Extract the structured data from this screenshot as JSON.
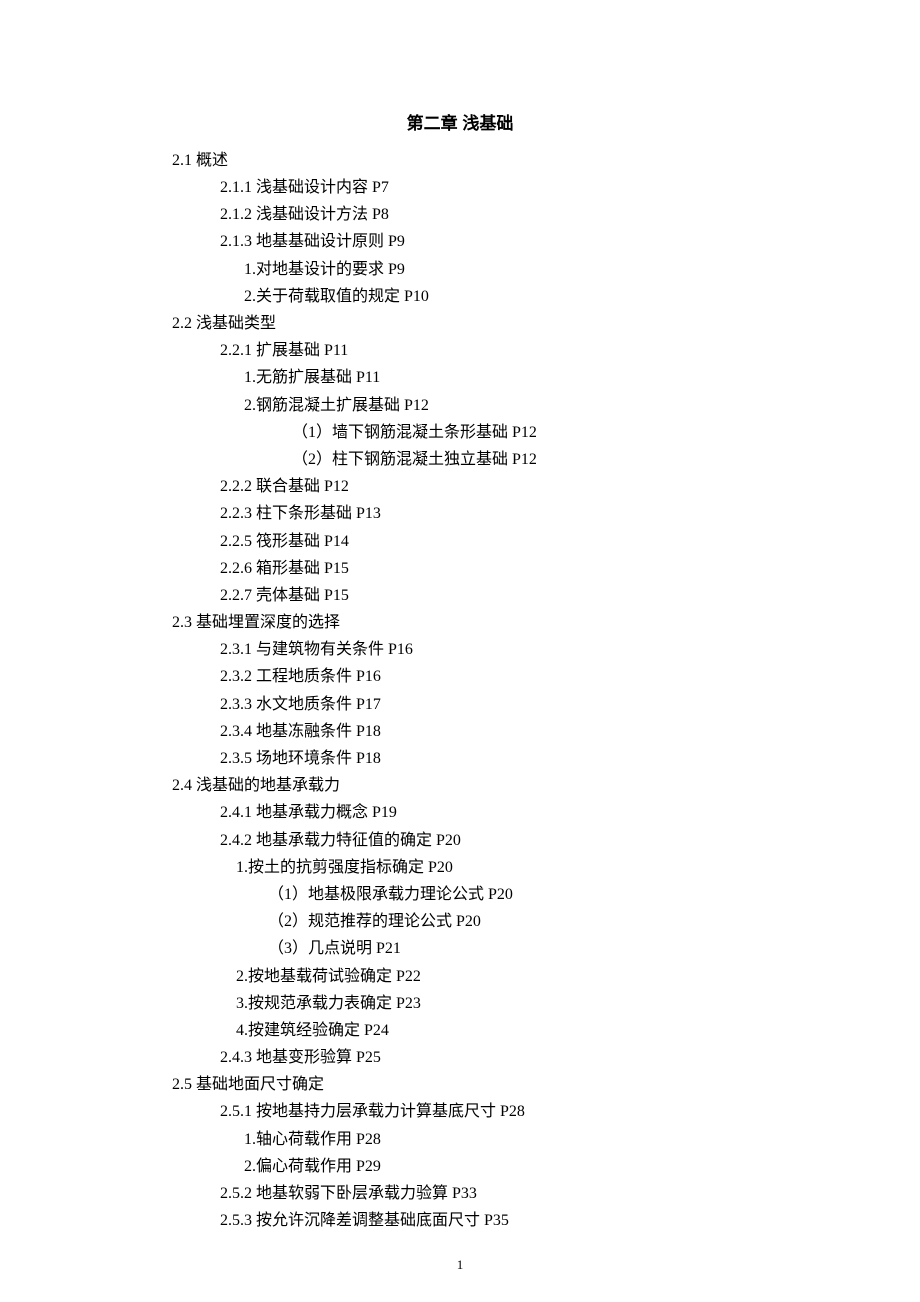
{
  "title": "第二章 浅基础",
  "page_number": "1",
  "toc": [
    {
      "lvl": "l1",
      "text": "2.1 概述"
    },
    {
      "lvl": "l2",
      "text": "2.1.1 浅基础设计内容 P7"
    },
    {
      "lvl": "l2",
      "text": "2.1.2 浅基础设计方法 P8"
    },
    {
      "lvl": "l2",
      "text": "2.1.3 地基基础设计原则 P9"
    },
    {
      "lvl": "l3",
      "text": "1.对地基设计的要求 P9"
    },
    {
      "lvl": "l3",
      "text": "2.关于荷载取值的规定 P10"
    },
    {
      "lvl": "l1",
      "text": "2.2 浅基础类型"
    },
    {
      "lvl": "l2",
      "text": "2.2.1 扩展基础 P11"
    },
    {
      "lvl": "l3",
      "text": "1.无筋扩展基础 P11"
    },
    {
      "lvl": "l3",
      "text": "2.钢筋混凝土扩展基础 P12"
    },
    {
      "lvl": "l4",
      "text": "（1）墙下钢筋混凝土条形基础 P12"
    },
    {
      "lvl": "l4",
      "text": "（2）柱下钢筋混凝土独立基础 P12"
    },
    {
      "lvl": "l2",
      "text": "2.2.2 联合基础 P12"
    },
    {
      "lvl": "l2",
      "text": "2.2.3 柱下条形基础 P13"
    },
    {
      "lvl": "l2",
      "text": "2.2.5 筏形基础 P14"
    },
    {
      "lvl": "l2",
      "text": "2.2.6 箱形基础 P15"
    },
    {
      "lvl": "l2",
      "text": "2.2.7 壳体基础 P15"
    },
    {
      "lvl": "l1",
      "text": "2.3 基础埋置深度的选择"
    },
    {
      "lvl": "l2",
      "text": "2.3.1 与建筑物有关条件 P16"
    },
    {
      "lvl": "l2",
      "text": "2.3.2 工程地质条件 P16"
    },
    {
      "lvl": "l2",
      "text": "2.3.3 水文地质条件 P17"
    },
    {
      "lvl": "l2",
      "text": "2.3.4 地基冻融条件 P18"
    },
    {
      "lvl": "l2",
      "text": "2.3.5 场地环境条件 P18"
    },
    {
      "lvl": "l1",
      "text": "2.4 浅基础的地基承载力"
    },
    {
      "lvl": "l2",
      "text": "2.4.1 地基承载力概念 P19"
    },
    {
      "lvl": "l2",
      "text": "2.4.2 地基承载力特征值的确定 P20"
    },
    {
      "lvl": "l3b",
      "text": "1.按土的抗剪强度指标确定 P20"
    },
    {
      "lvl": "l4b",
      "text": "（1）地基极限承载力理论公式 P20"
    },
    {
      "lvl": "l4b",
      "text": "（2）规范推荐的理论公式 P20"
    },
    {
      "lvl": "l4b",
      "text": "（3）几点说明 P21"
    },
    {
      "lvl": "l3b",
      "text": "2.按地基载荷试验确定 P22"
    },
    {
      "lvl": "l3b",
      "text": "3.按规范承载力表确定 P23"
    },
    {
      "lvl": "l3b",
      "text": "4.按建筑经验确定 P24"
    },
    {
      "lvl": "l2",
      "text": "2.4.3 地基变形验算 P25"
    },
    {
      "lvl": "l1",
      "text": "2.5 基础地面尺寸确定"
    },
    {
      "lvl": "l2",
      "text": "2.5.1 按地基持力层承载力计算基底尺寸 P28"
    },
    {
      "lvl": "l3",
      "text": "1.轴心荷载作用 P28"
    },
    {
      "lvl": "l3",
      "text": "2.偏心荷载作用 P29"
    },
    {
      "lvl": "l2",
      "text": "2.5.2 地基软弱下卧层承载力验算 P33"
    },
    {
      "lvl": "l2",
      "text": "2.5.3 按允许沉降差调整基础底面尺寸 P35"
    }
  ]
}
